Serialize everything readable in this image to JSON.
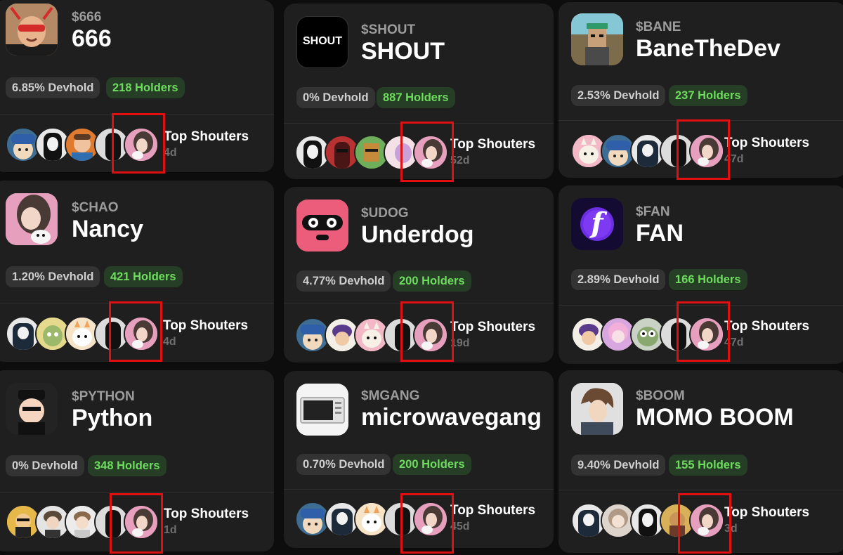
{
  "labels": {
    "top_shouters": "Top Shouters"
  },
  "colors": {
    "background": "#0d0d0d",
    "card": "#1f1f1f",
    "devhold_bg": "#333333",
    "holders_bg": "#263d26",
    "holders_text": "#6edc5f",
    "highlight": "#e01010"
  },
  "cards": [
    {
      "ticker": "$666",
      "name": "666",
      "devhold": "6.85% Devhold",
      "holders": "218 Holders",
      "age": "4d",
      "avatar_icon": "red-glasses-man-avatar"
    },
    {
      "ticker": "$SHOUT",
      "name": "SHOUT",
      "devhold": "0% Devhold",
      "holders": "887 Holders",
      "age": "52d",
      "avatar_icon": "shout-logo",
      "logo_text": "SHOUT"
    },
    {
      "ticker": "$BANE",
      "name": "BaneTheDev",
      "devhold": "2.53% Devhold",
      "holders": "237 Holders",
      "age": "47d",
      "avatar_icon": "pixel-character-avatar"
    },
    {
      "ticker": "$CHAO",
      "name": "Nancy",
      "devhold": "1.20% Devhold",
      "holders": "421 Holders",
      "age": "4d",
      "avatar_icon": "girl-with-cat-avatar"
    },
    {
      "ticker": "$UDOG",
      "name": "Underdog",
      "devhold": "4.77% Devhold",
      "holders": "200 Holders",
      "age": "19d",
      "avatar_icon": "pink-masked-face-avatar"
    },
    {
      "ticker": "$FAN",
      "name": "FAN",
      "devhold": "2.89% Devhold",
      "holders": "166 Holders",
      "age": "47d",
      "avatar_icon": "purple-f-logo",
      "logo_text": "f"
    },
    {
      "ticker": "$PYTHON",
      "name": "Python",
      "devhold": "0% Devhold",
      "holders": "348 Holders",
      "age": "1d",
      "avatar_icon": "cartoon-python-character-avatar"
    },
    {
      "ticker": "$MGANG",
      "name": "microwavegang",
      "devhold": "0.70% Devhold",
      "holders": "200 Holders",
      "age": "45d",
      "avatar_icon": "microwave-avatar"
    },
    {
      "ticker": "$BOOM",
      "name": "MOMO BOOM",
      "devhold": "9.40% Devhold",
      "holders": "155 Holders",
      "age": "3d",
      "avatar_icon": "anime-boy-avatar"
    }
  ]
}
